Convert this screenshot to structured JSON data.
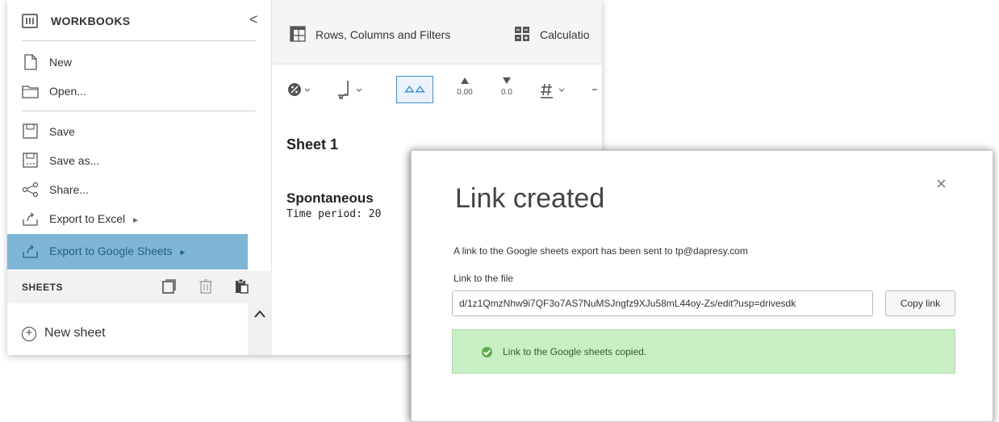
{
  "sidebar": {
    "title": "WORKBOOKS",
    "collapse_glyph": "<",
    "items": [
      {
        "label": "New",
        "icon": "file-icon"
      },
      {
        "label": "Open...",
        "icon": "folder-icon"
      },
      {
        "label": "Save",
        "icon": "save-icon"
      },
      {
        "label": "Save as...",
        "icon": "save-as-icon"
      },
      {
        "label": "Share...",
        "icon": "share-icon"
      },
      {
        "label": "Export to Excel",
        "icon": "export-icon",
        "arrow": "►"
      },
      {
        "label": "Export to Google Sheets",
        "icon": "export-icon",
        "arrow": "►"
      }
    ],
    "sheets_label": "SHEETS",
    "new_sheet_label": "New sheet"
  },
  "main": {
    "tabs": [
      {
        "label": "Rows, Columns and Filters"
      },
      {
        "label": "Calculatio"
      }
    ],
    "sheet_title": "Sheet 1",
    "report_title": "Spontaneous",
    "report_subtitle": "Time period: 20"
  },
  "toolbar": {
    "decimals_increase": "0.00",
    "decimals_decrease": "0.0"
  },
  "dialog": {
    "title": "Link created",
    "close_glyph": "×",
    "message": "A link to the Google sheets export has been sent to tp@dapresy.com",
    "link_label": "Link to the file",
    "link_value": "d/1z1QmzNhw9i7QF3o7AS7NuMSJngfz9XJu58mL44oy-Zs/edit?usp=drivesdk",
    "copy_label": "Copy link",
    "success_text": "Link to the Google sheets copied."
  },
  "colors": {
    "active_menu_bg": "#7fb6d5",
    "active_menu_text": "#1f5f8b",
    "success_bg": "#c8efc3",
    "success_icon": "#5cab4a",
    "toolbar_selected_border": "#3b8fd1"
  }
}
